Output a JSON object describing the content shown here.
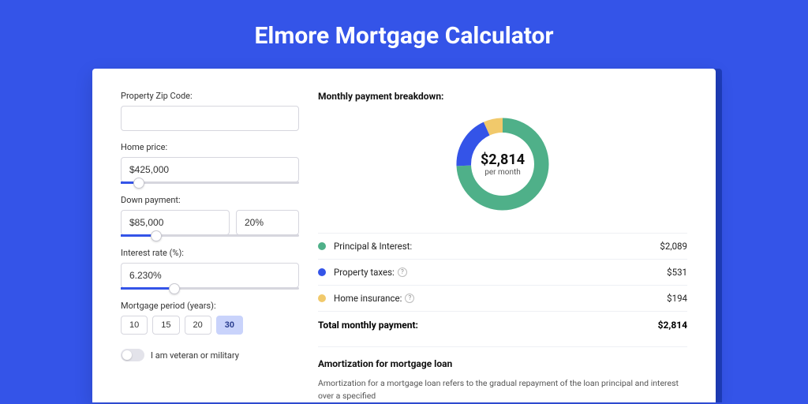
{
  "header": {
    "title": "Elmore Mortgage Calculator"
  },
  "form": {
    "zip": {
      "label": "Property Zip Code:",
      "value": ""
    },
    "home_price": {
      "label": "Home price:",
      "value": "$425,000",
      "slider_pct": 10
    },
    "down_payment": {
      "label": "Down payment:",
      "amount": "$85,000",
      "percent": "20%",
      "slider_pct": 20
    },
    "interest": {
      "label": "Interest rate (%):",
      "value": "6.230%",
      "slider_pct": 30
    },
    "period": {
      "label": "Mortgage period (years):",
      "options": [
        "10",
        "15",
        "20",
        "30"
      ],
      "active": "30"
    },
    "veteran": {
      "label": "I am veteran or military",
      "checked": false
    }
  },
  "breakdown": {
    "title": "Monthly payment breakdown:",
    "center_amount": "$2,814",
    "center_sub": "per month",
    "items": [
      {
        "label": "Principal & Interest:",
        "value": "$2,089",
        "color": "#4fb089",
        "pct": 74.2,
        "help": false
      },
      {
        "label": "Property taxes:",
        "value": "$531",
        "color": "#3454e8",
        "pct": 18.9,
        "help": true
      },
      {
        "label": "Home insurance:",
        "value": "$194",
        "color": "#f1c96b",
        "pct": 6.9,
        "help": true
      }
    ],
    "total_label": "Total monthly payment:",
    "total_value": "$2,814"
  },
  "amort": {
    "title": "Amortization for mortgage loan",
    "body": "Amortization for a mortgage loan refers to the gradual repayment of the loan principal and interest over a specified"
  },
  "chart_data": {
    "type": "pie",
    "title": "Monthly payment breakdown",
    "series": [
      {
        "name": "Principal & Interest",
        "value": 2089,
        "color": "#4fb089"
      },
      {
        "name": "Property taxes",
        "value": 531,
        "color": "#3454e8"
      },
      {
        "name": "Home insurance",
        "value": 194,
        "color": "#f1c96b"
      }
    ],
    "total": 2814,
    "center_label": "$2,814 per month"
  }
}
